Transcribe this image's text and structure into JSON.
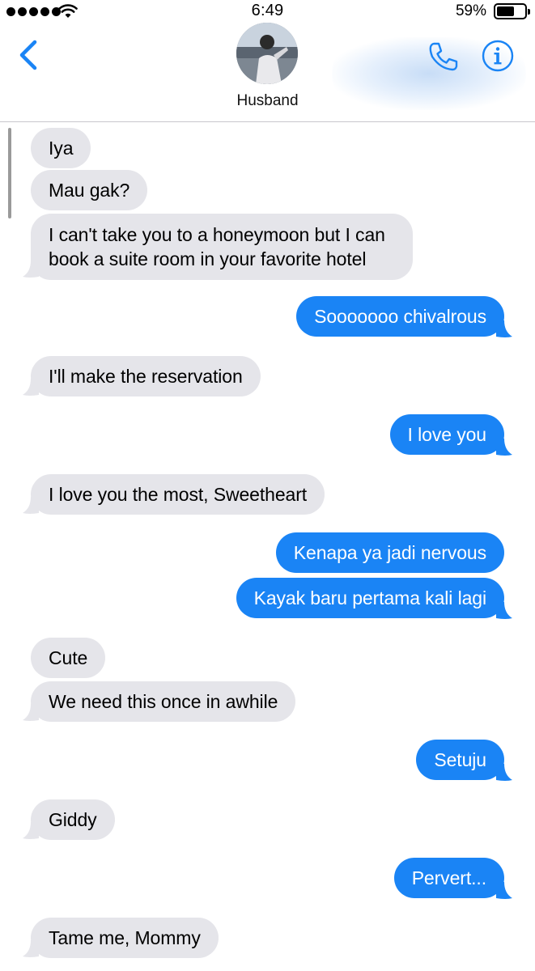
{
  "status_bar": {
    "time": "6:49",
    "battery_percent": "59%",
    "battery_level": 0.59,
    "signal_icon": "signal-dots-icon",
    "wifi_icon": "wifi-icon"
  },
  "header": {
    "contact_name": "Husband",
    "back_icon": "chevron-left-icon",
    "call_icon": "phone-icon",
    "info_icon": "info-icon"
  },
  "colors": {
    "incoming_bubble": "#e5e5ea",
    "outgoing_bubble": "#1a84f5",
    "accent": "#1a84f5"
  },
  "messages": [
    {
      "direction": "in",
      "text": "Iya"
    },
    {
      "direction": "in",
      "text": "Mau gak?"
    },
    {
      "direction": "in",
      "text": "I can't take you to a honeymoon but I can book a suite room in your favorite hotel"
    },
    {
      "direction": "out",
      "text": "Sooooooo chivalrous"
    },
    {
      "direction": "in",
      "text": "I'll make the reservation"
    },
    {
      "direction": "out",
      "text": "I love you"
    },
    {
      "direction": "in",
      "text": "I love you the most, Sweetheart"
    },
    {
      "direction": "out",
      "text": "Kenapa ya jadi nervous"
    },
    {
      "direction": "out",
      "text": "Kayak baru pertama kali lagi"
    },
    {
      "direction": "in",
      "text": "Cute"
    },
    {
      "direction": "in",
      "text": "We need this once in awhile"
    },
    {
      "direction": "out",
      "text": "Setuju"
    },
    {
      "direction": "in",
      "text": "Giddy"
    },
    {
      "direction": "out",
      "text": "Pervert..."
    },
    {
      "direction": "in",
      "text": "Tame me, Mommy"
    }
  ]
}
